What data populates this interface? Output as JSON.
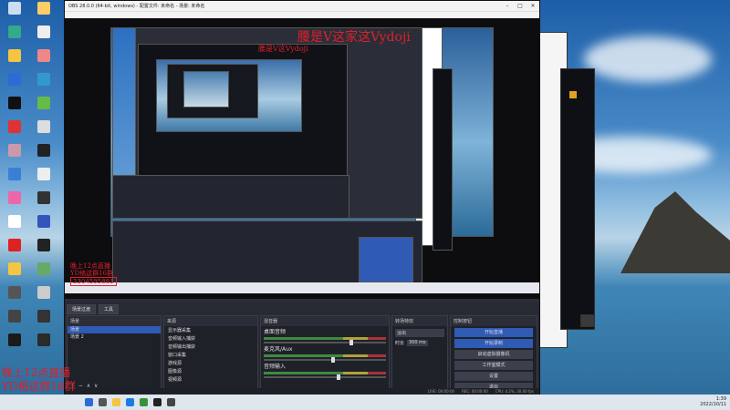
{
  "window": {
    "title": "OBS 28.0.0 (64-bit, windows) - 配置文件: 未命名 - 场景: 未命名"
  },
  "overlay": {
    "top_text": "腰是V这家这Vydoji",
    "small_text_1": "腰是V这Vydoji",
    "lines": [
      "晚上12点直播",
      "YD格这群16群"
    ],
    "number": "2304595881"
  },
  "tabs": [
    "场景过渡",
    "工具"
  ],
  "docks": {
    "scenes": {
      "title": "场景",
      "items": [
        "场景",
        "场景 2"
      ]
    },
    "sources": {
      "title": "来源",
      "items": [
        "显示器采集",
        "音频输入捕获",
        "音频输出捕获",
        "窗口采集",
        "游戏源",
        "图像源",
        "视频源"
      ]
    },
    "mixer": {
      "title": "混音器",
      "channels": [
        {
          "name": "桌面音频",
          "level": 0.7
        },
        {
          "name": "麦克风/Aux",
          "level": 0.55
        },
        {
          "name": "音频输入",
          "level": 0.6
        }
      ]
    },
    "transitions": {
      "title": "转场特效",
      "type": "淡出",
      "duration_label": "时长",
      "duration": "300 ms"
    },
    "controls": {
      "title": "控制按钮",
      "buttons": [
        {
          "label": "开始直播",
          "active": true
        },
        {
          "label": "开始录制",
          "active": true
        },
        {
          "label": "启动虚拟摄像机",
          "active": false
        },
        {
          "label": "工作室模式",
          "active": false
        },
        {
          "label": "设置",
          "active": false
        },
        {
          "label": "退出",
          "active": false
        }
      ]
    }
  },
  "status": {
    "live": "LIVE: 00:00:00",
    "rec": "REC: 00:00:00",
    "cpu": "CPU: 4.2%, 30.00 fps"
  },
  "taskbar": {
    "time": "1:39",
    "date": "2022/10/11"
  }
}
